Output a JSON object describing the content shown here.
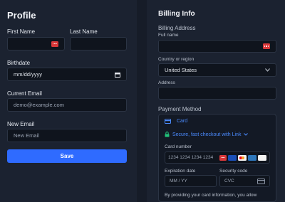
{
  "profile": {
    "title": "Profile",
    "first_name_label": "First Name",
    "last_name_label": "Last Name",
    "birthdate_label": "Birthdate",
    "birthdate_placeholder": "mm/dd/yyyy",
    "current_email_label": "Current Email",
    "current_email_value": "demo@example.com",
    "new_email_label": "New Email",
    "new_email_placeholder": "New Email",
    "save_label": "Save"
  },
  "billing": {
    "title": "Billing Info",
    "address_section": "Billing Address",
    "full_name_label": "Full name",
    "country_label": "Country or region",
    "country_value": "United States",
    "address_label": "Address",
    "payment_section": "Payment Method",
    "card_tab_label": "Card",
    "link_text": "Secure, fast checkout with Link",
    "card_number_label": "Card number",
    "card_number_placeholder": "1234 1234 1234 1234",
    "expiry_label": "Expiration date",
    "expiry_placeholder": "MM / YY",
    "cvc_label": "Security code",
    "cvc_placeholder": "CVC",
    "disclaimer": "By providing your card information, you allow"
  },
  "card_brands": [
    "visa",
    "mastercard",
    "amex",
    "discover"
  ],
  "colors": {
    "background": "#1b2230",
    "input_bg": "#0f141d",
    "accent": "#2f6bff",
    "link_green": "#21c27a",
    "link_blue": "#4b8bff",
    "password_icon": "#d9383a"
  }
}
